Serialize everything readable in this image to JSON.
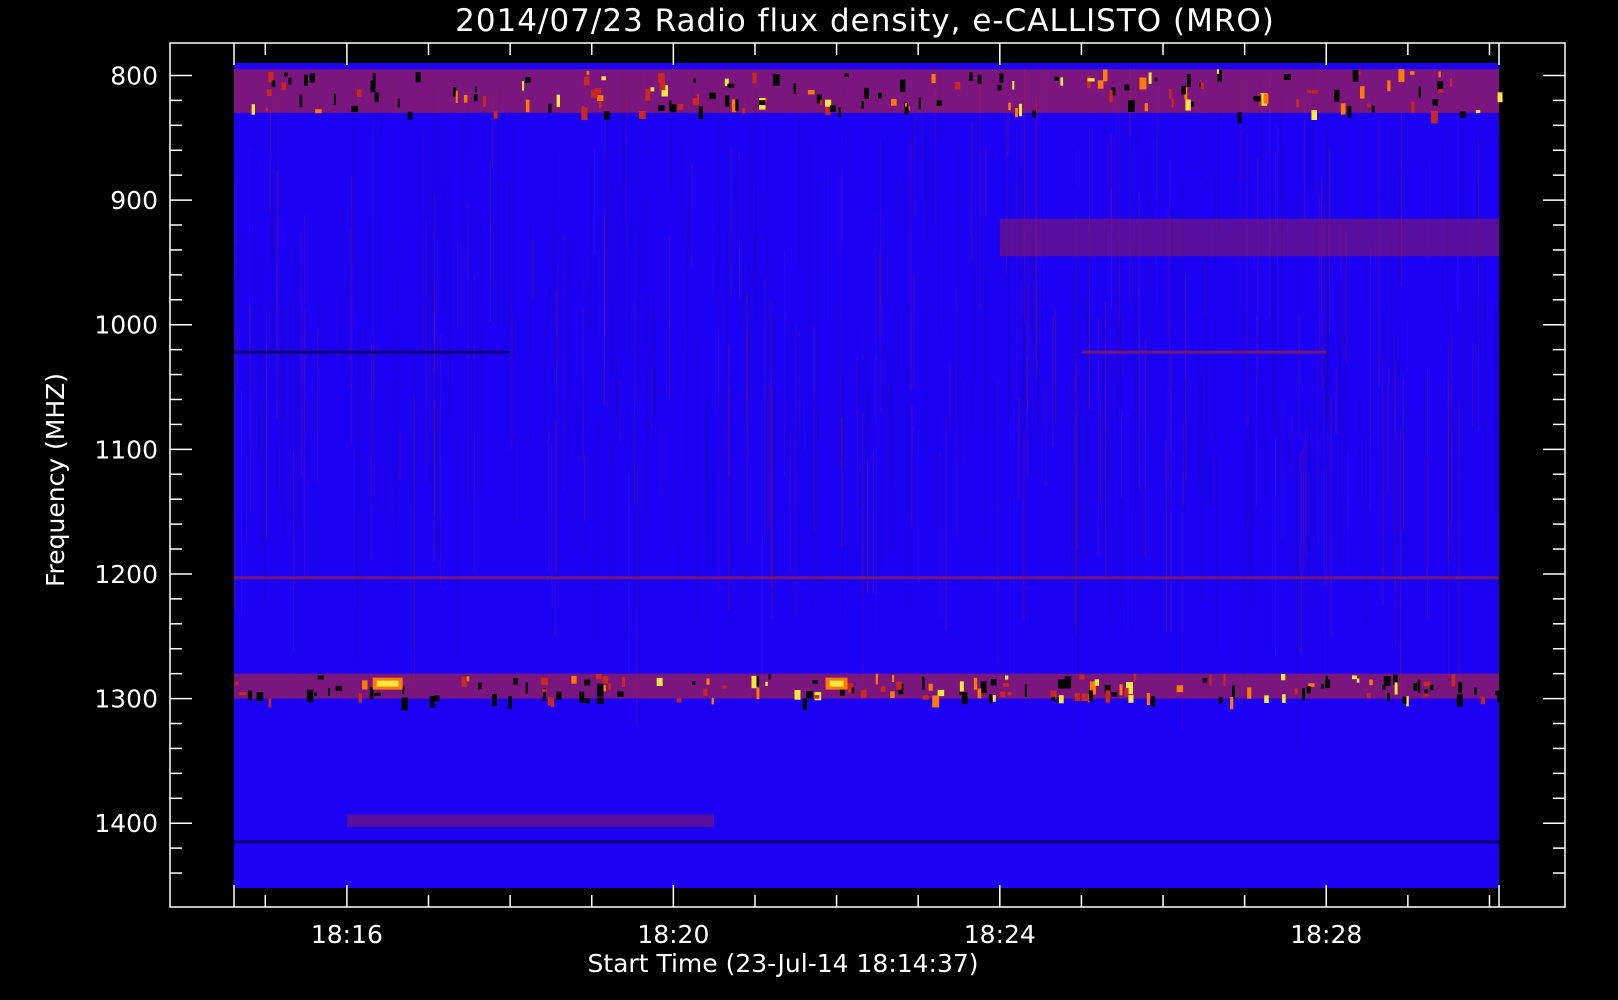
{
  "chart_data": {
    "type": "heatmap",
    "title": "2014/07/23  Radio flux density, e-CALLISTO (MRO)",
    "xlabel": "Start Time (23-Jul-14 18:14:37)",
    "ylabel": "Frequency (MHZ)",
    "x_axis": {
      "range": [
        "18:14:37",
        "18:30:07"
      ],
      "ticks": [
        "18:16",
        "18:20",
        "18:24",
        "18:28"
      ],
      "minor_tick_step_minutes": 1
    },
    "y_axis": {
      "range": [
        790,
        1452
      ],
      "inverted": true,
      "ticks": [
        800,
        900,
        1000,
        1100,
        1200,
        1300,
        1400
      ],
      "minor_tick_step": 20
    },
    "colormap": {
      "name": "blue-red-yellow",
      "colors": [
        "#000000",
        "#1a0a8c",
        "#1c00f4",
        "#8a1a5a",
        "#c8281e",
        "#ff7a00",
        "#ffe640"
      ]
    },
    "background_level": "#1c00f4",
    "features": [
      {
        "type": "band",
        "freq_mhz": [
          795,
          830
        ],
        "time": [
          "18:14:37",
          "18:30:07"
        ],
        "level": "high"
      },
      {
        "type": "band",
        "freq_mhz": [
          915,
          945
        ],
        "time": [
          "18:24:00",
          "18:30:07"
        ],
        "level": "medium"
      },
      {
        "type": "line",
        "freq_mhz": 1022,
        "time": [
          "18:14:37",
          "18:18:00"
        ],
        "level": "low"
      },
      {
        "type": "line",
        "freq_mhz": 1022,
        "time": [
          "18:25:00",
          "18:28:00"
        ],
        "level": "medium"
      },
      {
        "type": "line",
        "freq_mhz": 1203,
        "time": [
          "18:14:37",
          "18:30:07"
        ],
        "level": "medium"
      },
      {
        "type": "band",
        "freq_mhz": [
          1280,
          1300
        ],
        "time": [
          "18:14:37",
          "18:30:07"
        ],
        "level": "high"
      },
      {
        "type": "burst",
        "freq_mhz": 1288,
        "time": "18:16:30",
        "level": "peak"
      },
      {
        "type": "burst",
        "freq_mhz": 1288,
        "time": "18:22:00",
        "level": "high"
      },
      {
        "type": "band",
        "freq_mhz": [
          1393,
          1403
        ],
        "time": [
          "18:16:00",
          "18:20:30"
        ],
        "level": "medium"
      },
      {
        "type": "line",
        "freq_mhz": 1415,
        "time": [
          "18:14:37",
          "18:30:07"
        ],
        "level": "low"
      }
    ]
  }
}
